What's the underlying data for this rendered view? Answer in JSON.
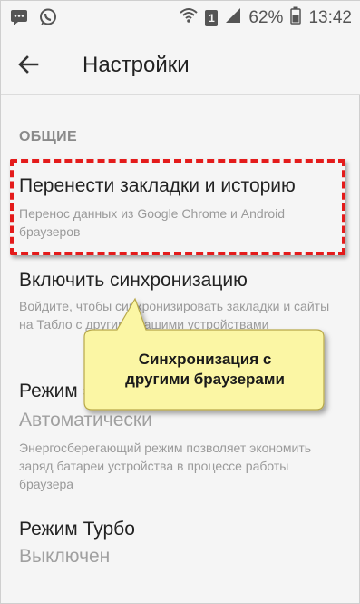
{
  "status_bar": {
    "battery_percent": "62%",
    "time": "13:42",
    "sim_label": "1"
  },
  "toolbar": {
    "title": "Настройки"
  },
  "section": {
    "header": "ОБЩИЕ"
  },
  "items": [
    {
      "title": "Перенести закладки и историю",
      "subtitle": "Перенос данных из Google Chrome и Android браузеров"
    },
    {
      "title": "Включить синхронизацию",
      "subtitle": "Войдите, чтобы синхронизировать закладки и сайты на Табло с другими вашими устройствами"
    },
    {
      "title": "Режим энергосбережения",
      "value": "Автоматически",
      "subtitle": "Энергосберегающий режим позволяет экономить заряд батареи устройства в процессе работы браузера"
    },
    {
      "title": "Режим Турбо",
      "value": "Выключен"
    }
  ],
  "callout": {
    "text": "Синхронизация с другими браузерами",
    "fill_color": "#fbf6a4",
    "border_color": "#b8a84a"
  },
  "highlight_color": "#e41b1b",
  "icons": {
    "back": "arrow-left-icon",
    "sms": "sms-icon",
    "whatsapp": "whatsapp-icon",
    "wifi": "wifi-icon",
    "signal": "signal-icon",
    "battery": "battery-icon"
  }
}
